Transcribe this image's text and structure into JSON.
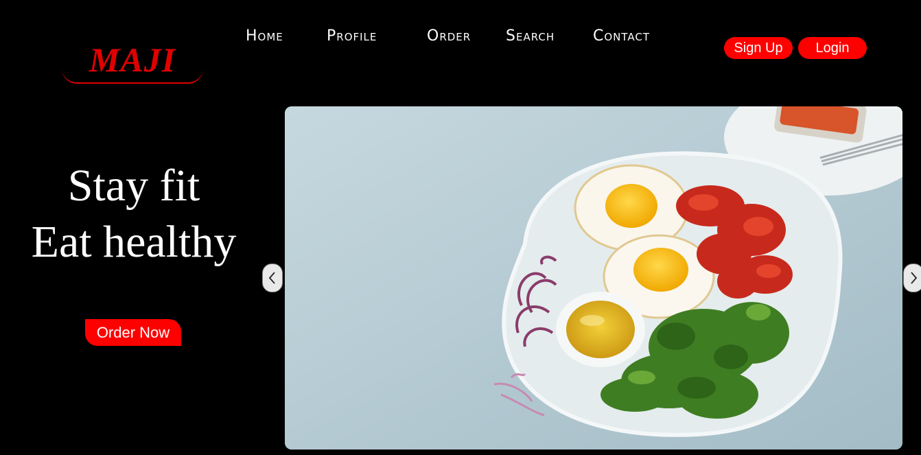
{
  "brand": {
    "name": "MAJI",
    "accent": "#ff0000"
  },
  "nav": {
    "items": [
      {
        "label": "Home"
      },
      {
        "label": "Profile"
      },
      {
        "label": "Order"
      },
      {
        "label": "Search"
      },
      {
        "label": "Contact"
      }
    ]
  },
  "auth": {
    "signup_label": "Sign Up",
    "login_label": "Login"
  },
  "hero": {
    "line1": "Stay fit",
    "line2": "Eat healthy",
    "cta_label": "Order Now"
  },
  "carousel": {
    "image": "breakfast-plate-image",
    "prev_icon": "chevron-left-icon",
    "next_icon": "chevron-right-icon"
  }
}
